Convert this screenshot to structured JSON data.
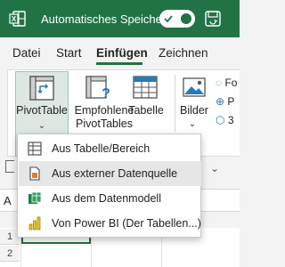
{
  "titlebar": {
    "autosave_label": "Automatisches Speichern",
    "toggle_state": "on"
  },
  "tabs": [
    {
      "label": "Datei"
    },
    {
      "label": "Start"
    },
    {
      "label": "Einfügen",
      "active": true
    },
    {
      "label": "Zeichnen"
    }
  ],
  "ribbon": {
    "pivottable_label": "PivotTable",
    "recommended_label_line1": "Empfohlene",
    "recommended_label_line2": "PivotTables",
    "table_label": "Tabelle",
    "images_label": "Bilder",
    "images_small_items": [
      "Fo",
      "P",
      "3"
    ]
  },
  "dropdown": {
    "items": [
      {
        "label": "Aus Tabelle/Bereich",
        "icon": "table-range-icon"
      },
      {
        "label": "Aus externer Datenquelle",
        "icon": "external-source-icon",
        "hover": true
      },
      {
        "label": "Aus dem Datenmodell",
        "icon": "data-model-icon"
      },
      {
        "label": "Von Power BI (Der Tabellen...)",
        "icon": "power-bi-icon"
      }
    ]
  },
  "sheet": {
    "namebox_text": "A",
    "row_numbers": [
      "1",
      "2"
    ]
  },
  "colors": {
    "excel_green": "#217346",
    "hover_gray": "#e6e6e6"
  }
}
